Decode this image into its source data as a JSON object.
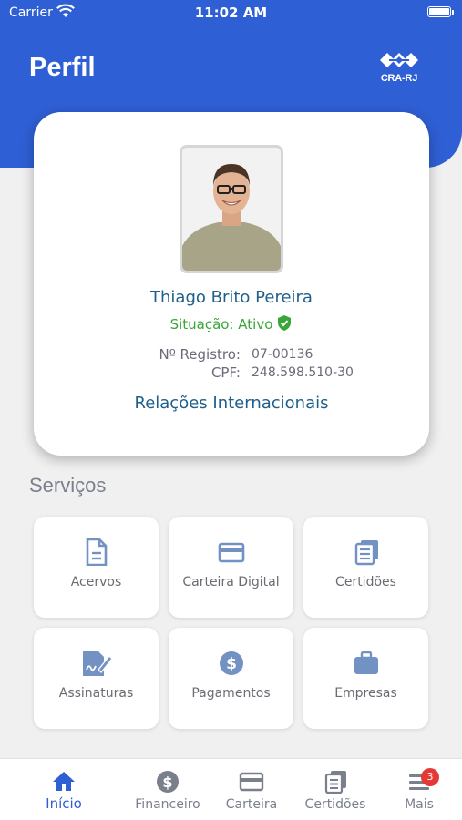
{
  "status_bar": {
    "carrier": "Carrier",
    "time": "11:02 AM"
  },
  "header": {
    "title": "Perfil",
    "logo_text": "CRA-RJ"
  },
  "profile": {
    "name": "Thiago Brito Pereira",
    "situacao": "Situação: Ativo",
    "registro_label": "Nº Registro:",
    "registro_value": "07-00136",
    "cpf_label": "CPF:",
    "cpf_value": "248.598.510-30",
    "link": "Relações Internacionais"
  },
  "services": {
    "title": "Serviços",
    "items": [
      {
        "label": "Acervos",
        "icon": "document-icon"
      },
      {
        "label": "Carteira Digital",
        "icon": "card-icon"
      },
      {
        "label": "Certidões",
        "icon": "certificates-icon"
      },
      {
        "label": "Assinaturas",
        "icon": "signature-icon"
      },
      {
        "label": "Pagamentos",
        "icon": "dollar-icon"
      },
      {
        "label": "Empresas",
        "icon": "briefcase-icon"
      }
    ]
  },
  "tabbar": {
    "items": [
      {
        "label": "Início",
        "icon": "home-icon",
        "active": true
      },
      {
        "label": "Financeiro",
        "icon": "dollar-icon"
      },
      {
        "label": "Carteira",
        "icon": "card-icon"
      },
      {
        "label": "Certidões",
        "icon": "certificates-icon"
      },
      {
        "label": "Mais",
        "icon": "menu-icon",
        "badge": "3"
      }
    ]
  },
  "colors": {
    "brand_blue": "#2f5fd4",
    "link_blue": "#1e5f8c",
    "active_green": "#3aa63a",
    "icon_blue": "#7392c4",
    "badge_red": "#e53935"
  }
}
